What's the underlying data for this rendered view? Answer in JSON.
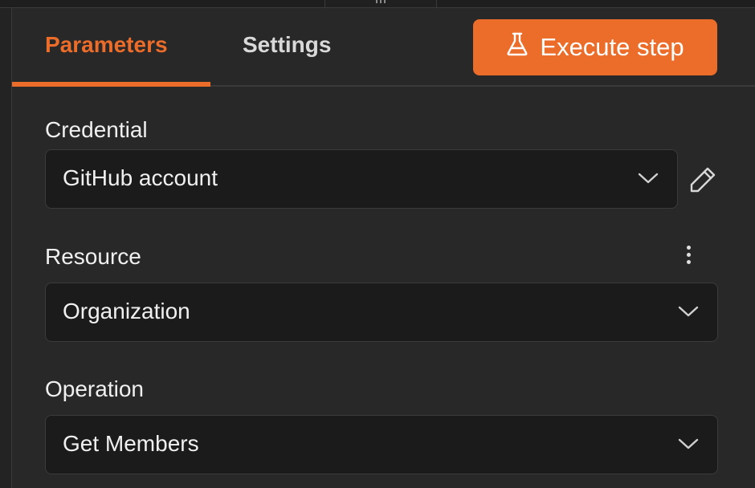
{
  "tabs": [
    {
      "label": "Parameters",
      "active": true
    },
    {
      "label": "Settings",
      "active": false
    }
  ],
  "execute_button": {
    "label": "Execute step",
    "icon": "flask-icon"
  },
  "fields": {
    "credential": {
      "label": "Credential",
      "value": "GitHub account",
      "action_icon": "pencil-icon"
    },
    "resource": {
      "label": "Resource",
      "value": "Organization",
      "action_icon": "kebab-menu-icon"
    },
    "operation": {
      "label": "Operation",
      "value": "Get Members"
    }
  },
  "colors": {
    "accent": "#ec6c2a",
    "background": "#282828",
    "input_background": "#1b1b1b",
    "text": "#f0f0f0"
  }
}
